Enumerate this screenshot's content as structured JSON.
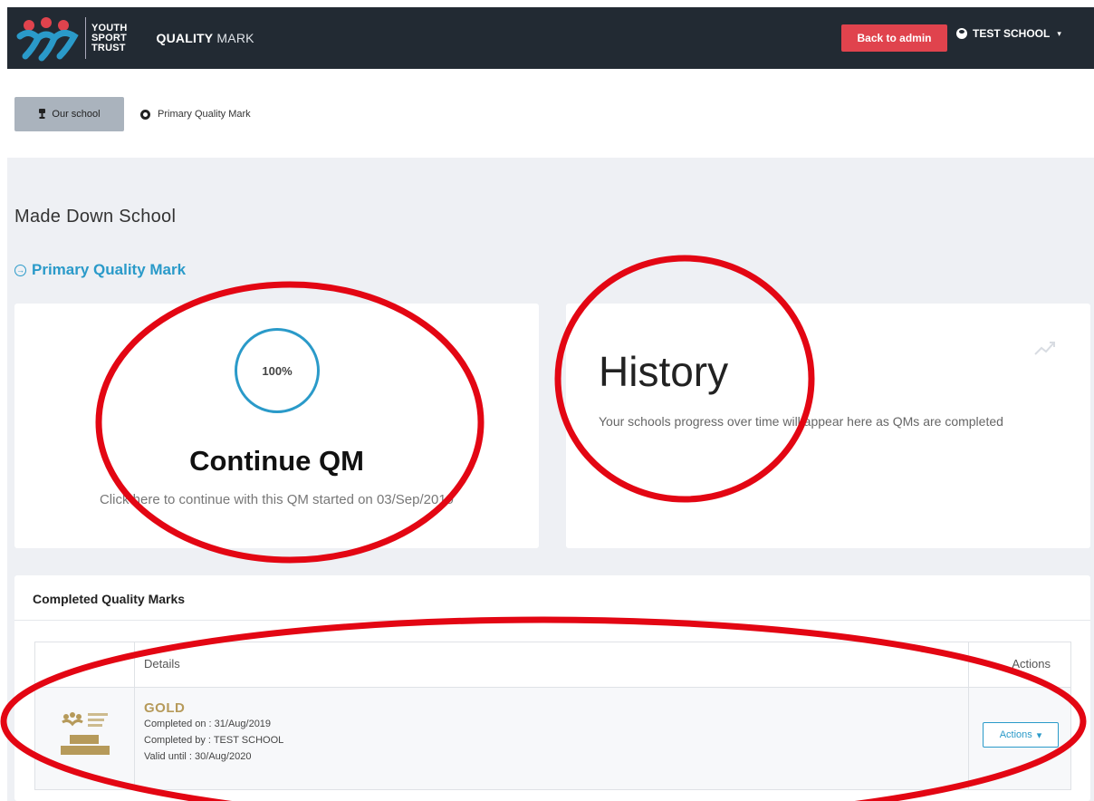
{
  "nav": {
    "logo_lines": [
      "YOUTH",
      "SPORT",
      "TRUST"
    ],
    "brand_bold": "QUALITY",
    "brand_light": " MARK",
    "back_button": "Back to admin",
    "user_label": "TEST SCHOOL",
    "caret": "▾"
  },
  "breadcrumb": {
    "school": "Our school",
    "current": "Primary Quality Mark"
  },
  "school_name": "Made Down School",
  "qm_heading": "Primary Quality Mark",
  "continue_card": {
    "progress": "100%",
    "progress_value": 1.0,
    "title": "Continue QM",
    "subtitle": "Click here to continue with this QM started on 03/Sep/2019"
  },
  "history_card": {
    "title": "History",
    "text": "Your schools progress over time will appear here as QMs are completed",
    "icon": "line-chart-icon"
  },
  "completed": {
    "header": "Completed Quality Marks",
    "columns": {
      "details": "Details",
      "actions": "Actions"
    },
    "rows": [
      {
        "level": "GOLD",
        "completed_on": "Completed on : 31/Aug/2019",
        "completed_by": "Completed by : TEST SCHOOL",
        "valid_until": "Valid until : 30/Aug/2020",
        "action_label": "Actions",
        "badge_text": "GOLD QUALITY MARK"
      }
    ]
  },
  "colors": {
    "nav_bg": "#222a33",
    "accent": "#2a9ac9",
    "danger": "#e0434d",
    "gold": "#b69a5a",
    "annotation": "#e30613"
  }
}
